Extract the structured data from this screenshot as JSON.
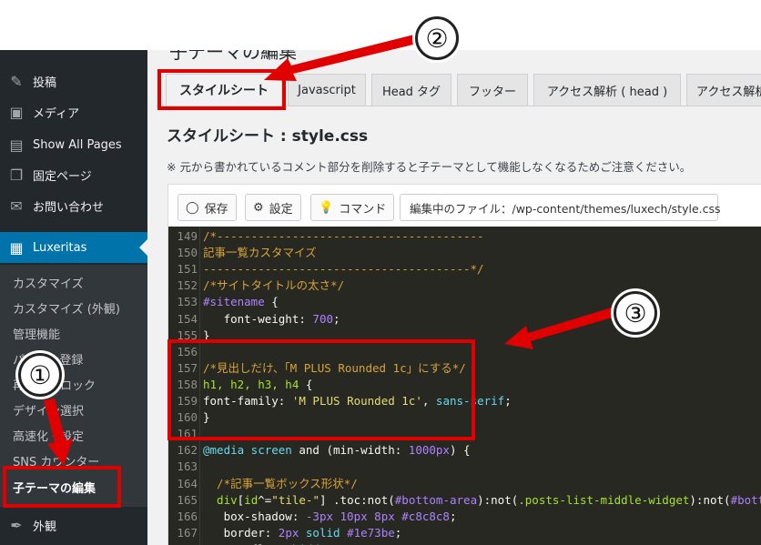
{
  "sidebar": {
    "items": [
      {
        "label": "投稿",
        "icon": "pin-icon"
      },
      {
        "label": "メディア",
        "icon": "media-icon"
      },
      {
        "label": "Show All Pages",
        "icon": "pages-list-icon"
      },
      {
        "label": "固定ページ",
        "icon": "page-icon"
      },
      {
        "label": "お問い合わせ",
        "icon": "mail-icon"
      },
      {
        "label": "Luxeritas",
        "icon": "luxeritas-icon"
      }
    ],
    "submenu": [
      "カスタマイズ",
      "カスタマイズ (外観)",
      "管理機能",
      "パターン登録",
      "再利用ブロック",
      "デザイン選択",
      "高速化・設定",
      "SNS カウンター",
      "子テーマの編集"
    ],
    "bottom_item": {
      "label": "外観",
      "icon": "brush-icon"
    }
  },
  "page": {
    "title": "子テーマの編集"
  },
  "tabs": [
    "スタイルシート",
    "Javascript",
    "Head タグ",
    "フッター",
    "アクセス解析 ( head )",
    "アクセス解析"
  ],
  "section_title": "スタイルシート :  style.css",
  "notice": "※ 元から書かれているコメント部分を削除すると子テーマとして機能しなくなるためご注意ください。",
  "toolbar": {
    "save": "保存",
    "settings": "設定",
    "command": "コマンド",
    "file_label": "編集中のファイル：/wp-content/themes/luxech/style.css"
  },
  "code_lines": [
    {
      "n": "149",
      "parts": [
        [
          "cm",
          "/*---------------------------------------"
        ]
      ]
    },
    {
      "n": "150",
      "parts": [
        [
          "cm",
          "記事一覧カスタマイズ"
        ]
      ]
    },
    {
      "n": "151",
      "parts": [
        [
          "cm",
          "---------------------------------------*/"
        ]
      ]
    },
    {
      "n": "152",
      "parts": [
        [
          "cm",
          "/*サイトタイトルの太さ*/"
        ]
      ]
    },
    {
      "n": "153",
      "parts": [
        [
          "id",
          "#sitename"
        ],
        [
          "p",
          " {"
        ]
      ]
    },
    {
      "n": "154",
      "parts": [
        [
          "prop",
          "   font-weight"
        ],
        [
          "p",
          ": "
        ],
        [
          "num",
          "700"
        ],
        [
          "p",
          ";"
        ]
      ]
    },
    {
      "n": "155",
      "parts": [
        [
          "p",
          "}"
        ]
      ]
    },
    {
      "n": "156",
      "parts": []
    },
    {
      "n": "157",
      "parts": [
        [
          "cm",
          "/*見出しだけ、「M PLUS Rounded 1c」にする*/"
        ]
      ]
    },
    {
      "n": "158",
      "parts": [
        [
          "sel",
          "h1, h2, h3, h4"
        ],
        [
          "p",
          " {"
        ]
      ]
    },
    {
      "n": "159",
      "parts": [
        [
          "prop",
          "font-family"
        ],
        [
          "p",
          ": "
        ],
        [
          "str",
          "'M PLUS Rounded 1c'"
        ],
        [
          "p",
          ", "
        ],
        [
          "kw",
          "sans-serif"
        ],
        [
          "p",
          ";"
        ]
      ]
    },
    {
      "n": "160",
      "parts": [
        [
          "p",
          "}"
        ]
      ]
    },
    {
      "n": "161",
      "parts": []
    },
    {
      "n": "162",
      "parts": [
        [
          "kw",
          "@media screen "
        ],
        [
          "p",
          "and ("
        ],
        [
          "prop",
          "min-width"
        ],
        [
          "p",
          ": "
        ],
        [
          "num",
          "1000px"
        ],
        [
          "p",
          ") {"
        ]
      ]
    },
    {
      "n": "163",
      "parts": []
    },
    {
      "n": "164",
      "parts": [
        [
          "cm",
          "  /*記事一覧ボックス形状*/"
        ]
      ]
    },
    {
      "n": "165",
      "parts": [
        [
          "sel",
          "  div"
        ],
        [
          "p",
          "["
        ],
        [
          "sel",
          "id"
        ],
        [
          "p",
          "^="
        ],
        [
          "str",
          "\"tile-\""
        ],
        [
          "p",
          "] .toc:not("
        ],
        [
          "id",
          "#bottom-area"
        ],
        [
          "p",
          "):not("
        ],
        [
          "sel",
          ".posts-list-middle-widget"
        ],
        [
          "p",
          "):not("
        ],
        [
          "id",
          "#bottom-area"
        ],
        [
          "p",
          "):not("
        ],
        [
          "sel",
          ".posts-lis"
        ]
      ]
    },
    {
      "n": "166",
      "parts": [
        [
          "prop",
          "   box-shadow"
        ],
        [
          "p",
          ": "
        ],
        [
          "num",
          "-3px 10px 8px "
        ],
        [
          "id",
          "#c8c8c8"
        ],
        [
          "p",
          ";"
        ]
      ]
    },
    {
      "n": "167",
      "parts": [
        [
          "prop",
          "   border"
        ],
        [
          "p",
          ": "
        ],
        [
          "num",
          "2px "
        ],
        [
          "kw",
          "solid "
        ],
        [
          "id",
          "#1e73be"
        ],
        [
          "p",
          ";"
        ]
      ]
    },
    {
      "n": "168",
      "parts": [
        [
          "prop",
          "   overflow"
        ],
        [
          "p",
          ": "
        ],
        [
          "kw",
          "hidden"
        ],
        [
          "p",
          ";"
        ]
      ]
    }
  ],
  "annotations": [
    "①",
    "②",
    "③"
  ],
  "colors": {
    "sidebar_bg": "#23282d",
    "submenu_bg": "#32373c",
    "active_blue": "#0073aa",
    "editor_bg": "#272822",
    "annotation_red": "#e00000"
  }
}
